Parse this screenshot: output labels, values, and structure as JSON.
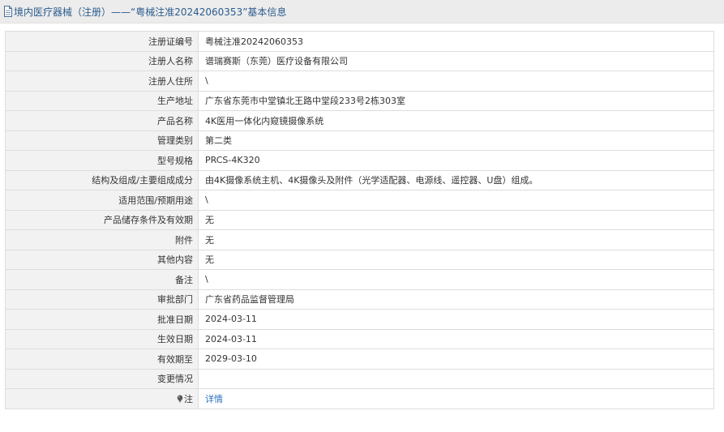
{
  "header": {
    "title": "境内医疗器械（注册）——“粤械注准20242060353”基本信息",
    "icon": "document-icon"
  },
  "rows": [
    {
      "label": "注册证编号",
      "value": "粤械注准20242060353"
    },
    {
      "label": "注册人名称",
      "value": "谱瑞赛斯（东莞）医疗设备有限公司"
    },
    {
      "label": "注册人住所",
      "value": "\\"
    },
    {
      "label": "生产地址",
      "value": "广东省东莞市中堂镇北王路中堂段233号2栋303室"
    },
    {
      "label": "产品名称",
      "value": "4K医用一体化内窥镜摄像系统"
    },
    {
      "label": "管理类别",
      "value": "第二类"
    },
    {
      "label": "型号规格",
      "value": "PRCS-4K320"
    },
    {
      "label": "结构及组成/主要组成成分",
      "value": "由4K摄像系统主机、4K摄像头及附件（光学适配器、电源线、遥控器、U盘）组成。"
    },
    {
      "label": "适用范围/预期用途",
      "value": "\\"
    },
    {
      "label": "产品储存条件及有效期",
      "value": "无"
    },
    {
      "label": "附件",
      "value": "无"
    },
    {
      "label": "其他内容",
      "value": "无"
    },
    {
      "label": "备注",
      "value": "\\"
    },
    {
      "label": "审批部门",
      "value": "广东省药品监督管理局"
    },
    {
      "label": "批准日期",
      "value": "2024-03-11"
    },
    {
      "label": "生效日期",
      "value": "2024-03-11"
    },
    {
      "label": "有效期至",
      "value": "2029-03-10"
    },
    {
      "label": "变更情况",
      "value": ""
    }
  ],
  "note_row": {
    "label": "注",
    "icon": "lightbulb-icon",
    "link_text": "详情"
  },
  "colors": {
    "header_bg": "#ececec",
    "header_text": "#2b5c8e",
    "label_bg": "#f2f2f2",
    "border": "#dddddd",
    "link": "#2a6fc1"
  }
}
